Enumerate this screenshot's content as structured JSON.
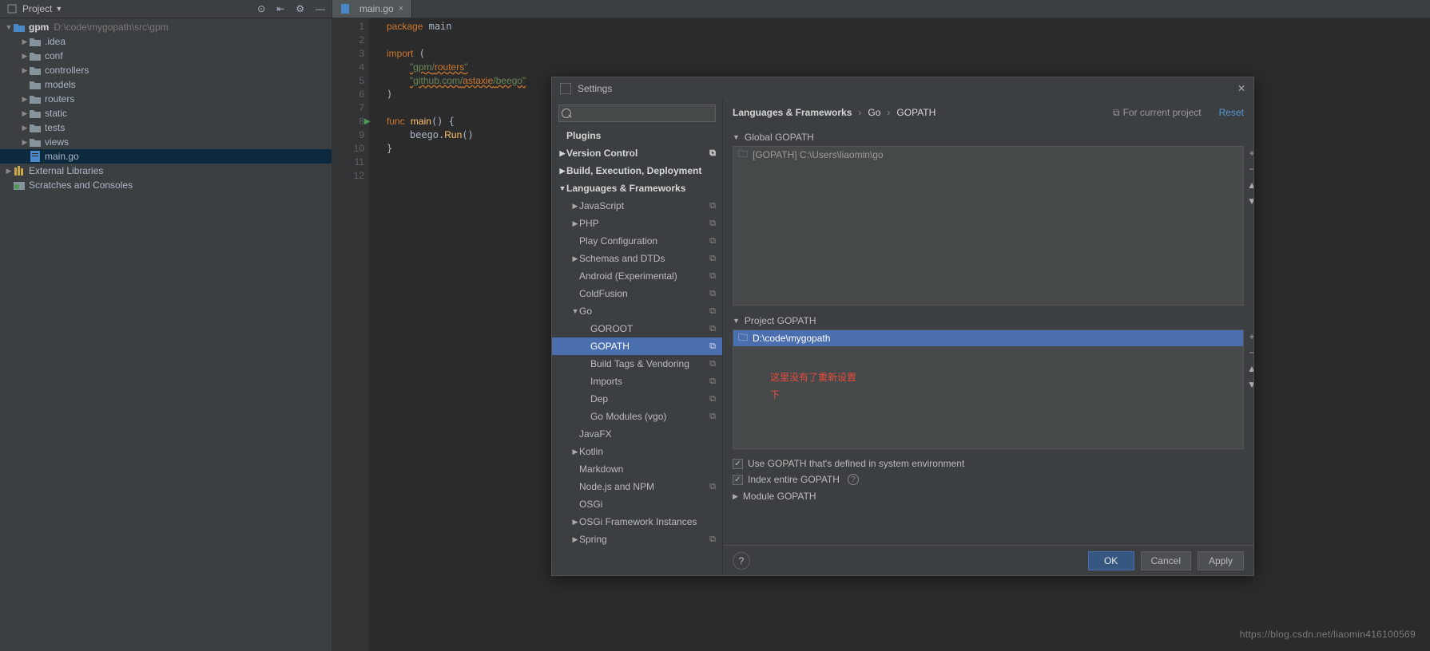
{
  "sidebar": {
    "title": "Project",
    "root": {
      "name": "gpm",
      "path": "D:\\code\\mygopath\\src\\gpm"
    },
    "folders": [
      ".idea",
      "conf",
      "controllers",
      "models",
      "routers",
      "static",
      "tests",
      "views"
    ],
    "file": "main.go",
    "external": "External Libraries",
    "scratches": "Scratches and Consoles"
  },
  "tab": {
    "name": "main.go"
  },
  "code": {
    "l1": "package main",
    "l3": "import (",
    "l4": "\"gpm/routers\"",
    "l5": "\"github.com/astaxie/beego\"",
    "l6": ")",
    "l8": "func main() {",
    "l9": "    beego.Run()",
    "l10": "}",
    "lines": [
      "1",
      "2",
      "3",
      "4",
      "5",
      "6",
      "7",
      "8",
      "9",
      "10",
      "11",
      "12"
    ]
  },
  "dialog": {
    "title": "Settings",
    "search_ph": "",
    "nav": {
      "plugins": "Plugins",
      "vcs": "Version Control",
      "build": "Build, Execution, Deployment",
      "lang": "Languages & Frameworks",
      "js": "JavaScript",
      "php": "PHP",
      "play": "Play Configuration",
      "schemas": "Schemas and DTDs",
      "android": "Android (Experimental)",
      "cold": "ColdFusion",
      "go": "Go",
      "goroot": "GOROOT",
      "gopath": "GOPATH",
      "tags": "Build Tags & Vendoring",
      "imports": "Imports",
      "dep": "Dep",
      "vgo": "Go Modules (vgo)",
      "javafx": "JavaFX",
      "kotlin": "Kotlin",
      "markdown": "Markdown",
      "node": "Node.js and NPM",
      "osgi": "OSGi",
      "osgifw": "OSGi Framework Instances",
      "spring": "Spring"
    },
    "crumb": {
      "a": "Languages & Frameworks",
      "b": "Go",
      "c": "GOPATH"
    },
    "for_project": "For current project",
    "reset": "Reset",
    "global_head": "Global GOPATH",
    "global_entry": "[GOPATH] C:\\Users\\liaomin\\go",
    "project_head": "Project GOPATH",
    "project_entry": "D:\\code\\mygopath",
    "annotation_l1": "这里没有了重新设置",
    "annotation_l2": "下",
    "cb1": "Use GOPATH that's defined in system environment",
    "cb2": "Index entire GOPATH",
    "module_head": "Module GOPATH",
    "ok": "OK",
    "cancel": "Cancel",
    "apply": "Apply"
  },
  "watermark": "https://blog.csdn.net/liaomin416100569"
}
